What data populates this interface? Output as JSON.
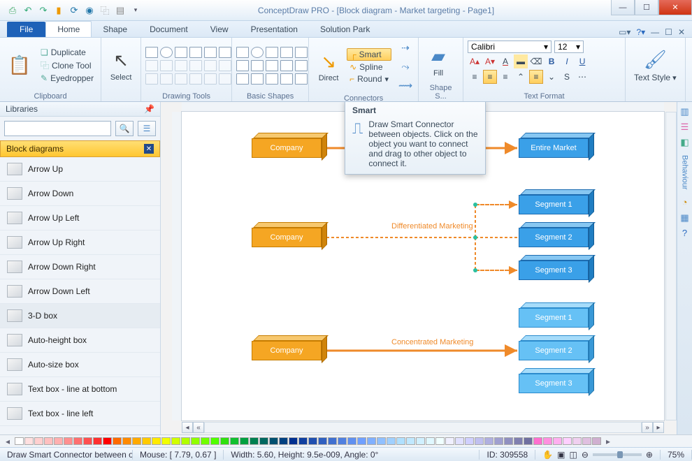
{
  "app": {
    "title": "ConceptDraw PRO - [Block diagram - Market targeting - Page1]"
  },
  "qat_icons": [
    "save-icon",
    "undo-icon",
    "redo-icon",
    "cut-icon",
    "copy-icon",
    "paste-icon",
    "print-icon",
    "dropdown-icon"
  ],
  "tabs": {
    "file": "File",
    "items": [
      "Home",
      "Shape",
      "Document",
      "View",
      "Presentation",
      "Solution Park"
    ],
    "active": "Home"
  },
  "ribbon": {
    "clipboard": {
      "label": "Clipboard",
      "duplicate": "Duplicate",
      "clone": "Clone Tool",
      "eyedrop": "Eyedropper"
    },
    "select": {
      "label": "Select"
    },
    "drawing": {
      "label": "Drawing Tools"
    },
    "shapes": {
      "label": "Basic Shapes"
    },
    "connectors": {
      "label": "Connectors",
      "direct": "Direct",
      "smart": "Smart",
      "spline": "Spline",
      "round": "Round"
    },
    "shapes2": {
      "label": "Shape S..."
    },
    "fill": {
      "label": "Fill"
    },
    "textfmt": {
      "label": "Text Format",
      "font": "Calibri",
      "size": "12"
    },
    "textstyle": {
      "label": "Text Style"
    }
  },
  "libraries": {
    "header": "Libraries",
    "category": "Block diagrams",
    "items": [
      "Arrow Up",
      "Arrow Down",
      "Arrow Up Left",
      "Arrow Up Right",
      "Arrow Down Right",
      "Arrow Down Left",
      "3-D box",
      "Auto-height box",
      "Auto-size box",
      "Text box - line at bottom",
      "Text box - line left"
    ]
  },
  "tooltip": {
    "title": "Smart",
    "text": "Draw Smart Connector between objects. Click on the object you want to connect and drag to other object to connect it."
  },
  "canvas_boxes": {
    "c1": "Company",
    "c2": "Company",
    "c3": "Company",
    "em": "Entire Market",
    "s1a": "Segment 1",
    "s1b": "Segment 2",
    "s1c": "Segment 3",
    "s2a": "Segment 1",
    "s2b": "Segment 2",
    "s2c": "Segment 3",
    "lbl1": "Differentiated Marketing",
    "lbl2": "Concentrated Marketing"
  },
  "rightbar": {
    "behaviour": "Behaviour"
  },
  "colors": [
    "#ffffff",
    "#ffe0e0",
    "#ffd0d0",
    "#ffc0c0",
    "#ffb0b0",
    "#ff9090",
    "#ff7070",
    "#ff5050",
    "#ff3030",
    "#ff0000",
    "#ff6a00",
    "#ff8a00",
    "#ffaa00",
    "#ffca00",
    "#ffea00",
    "#f0ff00",
    "#d0ff00",
    "#b0ff00",
    "#90ff00",
    "#70ff00",
    "#50ff00",
    "#30e010",
    "#10c030",
    "#00a040",
    "#008050",
    "#006860",
    "#005070",
    "#004080",
    "#003090",
    "#1040a0",
    "#2050b0",
    "#3060c0",
    "#4070d0",
    "#5080e0",
    "#6090f0",
    "#70a0ff",
    "#80b0ff",
    "#90c0ff",
    "#a0d0ff",
    "#b0e0ff",
    "#c0e8ff",
    "#d0f0ff",
    "#e0f8ff",
    "#f0ffff",
    "#f0f0ff",
    "#e0e0ff",
    "#d0d0ff",
    "#c0c0f0",
    "#b0b0e0",
    "#a0a0d0",
    "#9090c0",
    "#8080b0",
    "#7070a0",
    "#ff70d0",
    "#ff90e0",
    "#ffb0f0",
    "#ffd0ff",
    "#f0d0f0",
    "#e0c0e0",
    "#d0b0d0"
  ],
  "status": {
    "hint": "Draw Smart Connector between obje",
    "mouse": "Mouse: [ 7.79, 0.67 ]",
    "dims": "Width: 5.60,  Height: 9.5e-009,  Angle: 0°",
    "id": "ID: 309558",
    "zoom": "75%"
  }
}
